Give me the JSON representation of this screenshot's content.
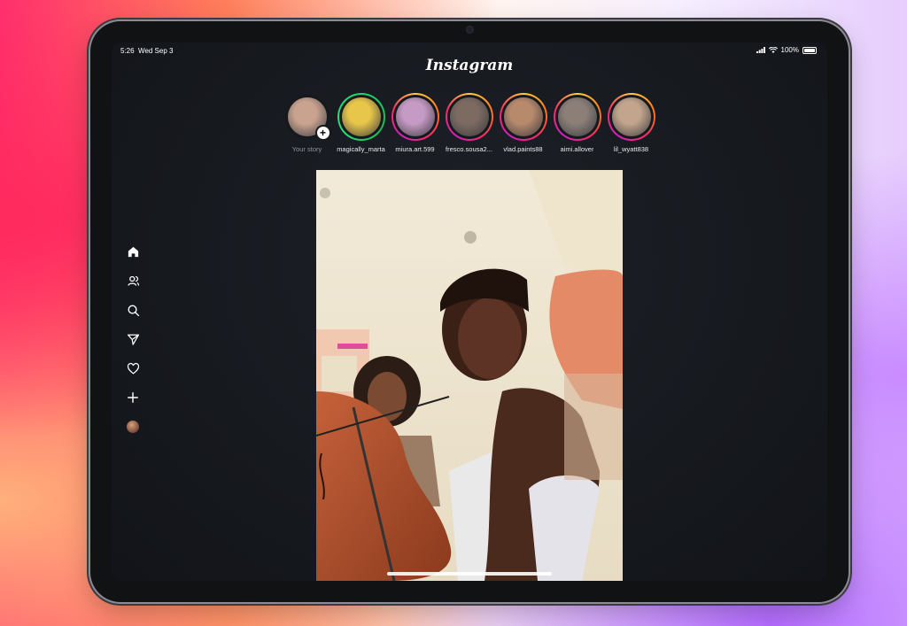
{
  "status_bar": {
    "time": "5:26",
    "date": "Wed Sep 3",
    "battery": "100%"
  },
  "app": {
    "title": "Instagram"
  },
  "stories": [
    {
      "username": "Your story",
      "ring": "none",
      "avatar_color": "#c9a38f"
    },
    {
      "username": "magically_marta",
      "ring": "close",
      "avatar_color": "#e7c64a"
    },
    {
      "username": "miura.art.599",
      "ring": "grad",
      "avatar_color": "#c59ac4"
    },
    {
      "username": "fresco.sousa2...",
      "ring": "grad",
      "avatar_color": "#7d6b62"
    },
    {
      "username": "vlad.paints88",
      "ring": "grad",
      "avatar_color": "#b78a6c"
    },
    {
      "username": "aimi.allover",
      "ring": "grad",
      "avatar_color": "#8b7f78"
    },
    {
      "username": "lil_wyatt838",
      "ring": "grad",
      "avatar_color": "#c2a58c"
    }
  ],
  "nav": [
    {
      "name": "home-icon"
    },
    {
      "name": "people-icon"
    },
    {
      "name": "search-icon"
    },
    {
      "name": "send-icon"
    },
    {
      "name": "heart-icon"
    },
    {
      "name": "plus-icon"
    },
    {
      "name": "profile-avatar"
    }
  ],
  "colors": {
    "story_ring_start": "#ffcf3d",
    "story_ring_end": "#d01fbf",
    "close_friends": "#22d36b",
    "screen_bg": "#16191e"
  }
}
